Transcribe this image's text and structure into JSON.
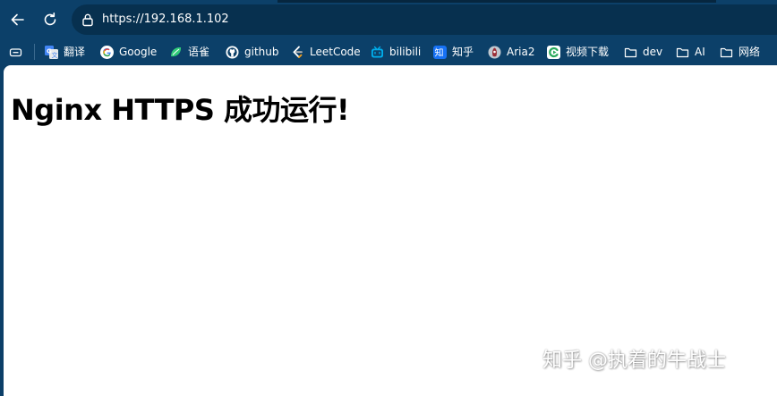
{
  "address_bar": {
    "url": "https://192.168.1.102"
  },
  "bookmarks": [
    {
      "label": "",
      "icon": "tab-groups-icon"
    },
    {
      "label": "翻译",
      "icon": "translate-icon"
    },
    {
      "label": "Google",
      "icon": "google-icon"
    },
    {
      "label": "语雀",
      "icon": "yuque-icon"
    },
    {
      "label": "github",
      "icon": "github-icon"
    },
    {
      "label": "LeetCode",
      "icon": "leetcode-icon"
    },
    {
      "label": "bilibili",
      "icon": "bilibili-icon"
    },
    {
      "label": "知乎",
      "icon": "zhihu-icon"
    },
    {
      "label": "Aria2",
      "icon": "aria2-icon"
    },
    {
      "label": "视频下载",
      "icon": "video-download-icon"
    },
    {
      "label": "dev",
      "icon": "folder-icon"
    },
    {
      "label": "AI",
      "icon": "folder-icon"
    },
    {
      "label": "网络",
      "icon": "folder-icon"
    }
  ],
  "page": {
    "heading": "Nginx HTTPS 成功运行!"
  },
  "watermark": "知乎 @执着的牛战士",
  "colors": {
    "frame": "#0c4069",
    "address_bar": "#07304f",
    "page_background": "#ffffff",
    "heading_text": "#000000"
  }
}
